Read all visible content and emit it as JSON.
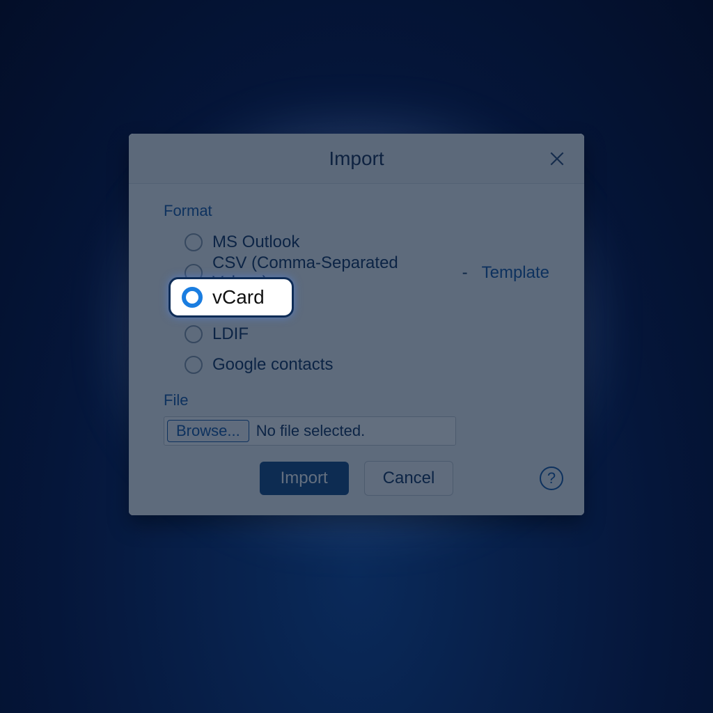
{
  "dialog": {
    "title": "Import",
    "format_label": "Format",
    "options": {
      "outlook": "MS Outlook",
      "csv": "CSV (Comma-Separated Values)",
      "csv_template_link": "Template",
      "vcard": "vCard",
      "ldif": "LDIF",
      "google": "Google contacts"
    },
    "file_label": "File",
    "browse_label": "Browse...",
    "file_status": "No file selected.",
    "import_button": "Import",
    "cancel_button": "Cancel",
    "help_label": "?"
  },
  "highlight": {
    "label": "vCard"
  }
}
